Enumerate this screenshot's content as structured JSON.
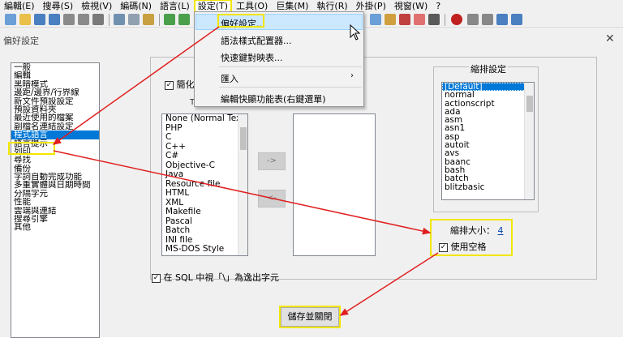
{
  "menubar": {
    "items": [
      "編輯(E)",
      "搜尋(S)",
      "檢視(V)",
      "編碼(N)",
      "語言(L)",
      "設定(T)",
      "工具(O)",
      "巨集(M)",
      "執行(R)",
      "外掛(P)",
      "視窗(W)",
      "?"
    ]
  },
  "settings_menu": {
    "items": [
      "偏好設定...",
      "語法樣式配置器...",
      "快速鍵對映表...",
      "匯入",
      "編輯快顯功能表(右鍵選單)"
    ]
  },
  "dialog": {
    "title": "偏好設定",
    "close": "✕",
    "categories": [
      "一般",
      "編輯",
      "黑暗模式",
      "邊距/邊界/行界線",
      "新文件預設設定",
      "預設資料夾",
      "最近使用的檔案",
      "副檔名連結設定",
      "程式語言",
      "語言提示",
      "列印",
      "尋找",
      "備份",
      "字詞自動完成功能",
      "多重實體與日期時間",
      "分隔字元",
      "性能",
      "雲端與連結",
      "搜尋引擎",
      "其他"
    ],
    "selected_category": "程式語言",
    "compact_label": "簡化",
    "tab_label": "T",
    "languages": [
      "None (Normal Text)",
      "PHP",
      "C",
      "C++",
      "C#",
      "Objective-C",
      "Java",
      "Resource file",
      "HTML",
      "XML",
      "Makefile",
      "Pascal",
      "Batch",
      "INI file",
      "MS-DOS Style"
    ],
    "move_right": "->",
    "move_left": "<-",
    "indent_title": "縮排設定",
    "indent_list": [
      "[Default]",
      "normal",
      "actionscript",
      "ada",
      "asm",
      "asn1",
      "asp",
      "autoit",
      "avs",
      "baanc",
      "bash",
      "batch",
      "blitzbasic"
    ],
    "indent_size_label": "縮排大小：",
    "indent_size_value": "4",
    "use_spaces_label": "使用空格",
    "sql_label": "在 SQL 中視「\\」為逸出字元",
    "save_button": "儲存並關閉"
  },
  "colors": {
    "highlight": "#f2e600",
    "arrow": "#e02020",
    "selection": "#0078d7"
  }
}
